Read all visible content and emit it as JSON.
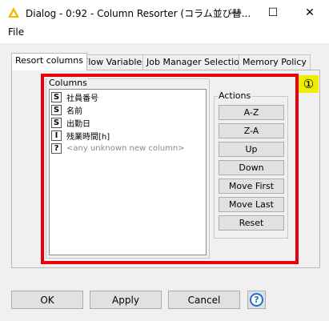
{
  "window": {
    "title": "Dialog - 0:92 - Column Resorter (コラム並び替...",
    "minimize_glyph": "—",
    "maximize_glyph": "☐",
    "close_glyph": "✕"
  },
  "menu": {
    "file": "File"
  },
  "tabs": [
    {
      "label": "Resort columns",
      "active": true
    },
    {
      "label": "Flow Variables",
      "active": false
    },
    {
      "label": "Job Manager Selection",
      "active": false
    },
    {
      "label": "Memory Policy",
      "active": false
    }
  ],
  "annotation_badge": "①",
  "columns": {
    "label": "Columns",
    "items": [
      {
        "type": "S",
        "name": "社員番号"
      },
      {
        "type": "S",
        "name": "名前"
      },
      {
        "type": "S",
        "name": "出勤日"
      },
      {
        "type": "I",
        "name": "残業時間[h]"
      },
      {
        "type": "?",
        "name": "<any unknown new column>",
        "unknown": true
      }
    ]
  },
  "actions": {
    "label": "Actions",
    "buttons": [
      "A-Z",
      "Z-A",
      "Up",
      "Down",
      "Move First",
      "Move Last",
      "Reset"
    ]
  },
  "footer": {
    "ok": "OK",
    "apply": "Apply",
    "cancel": "Cancel",
    "help": "?"
  },
  "colors": {
    "highlight": "#e8000b",
    "badge": "#f0ee00",
    "help": "#1e6fd0",
    "app_icon": "#f5b800"
  }
}
